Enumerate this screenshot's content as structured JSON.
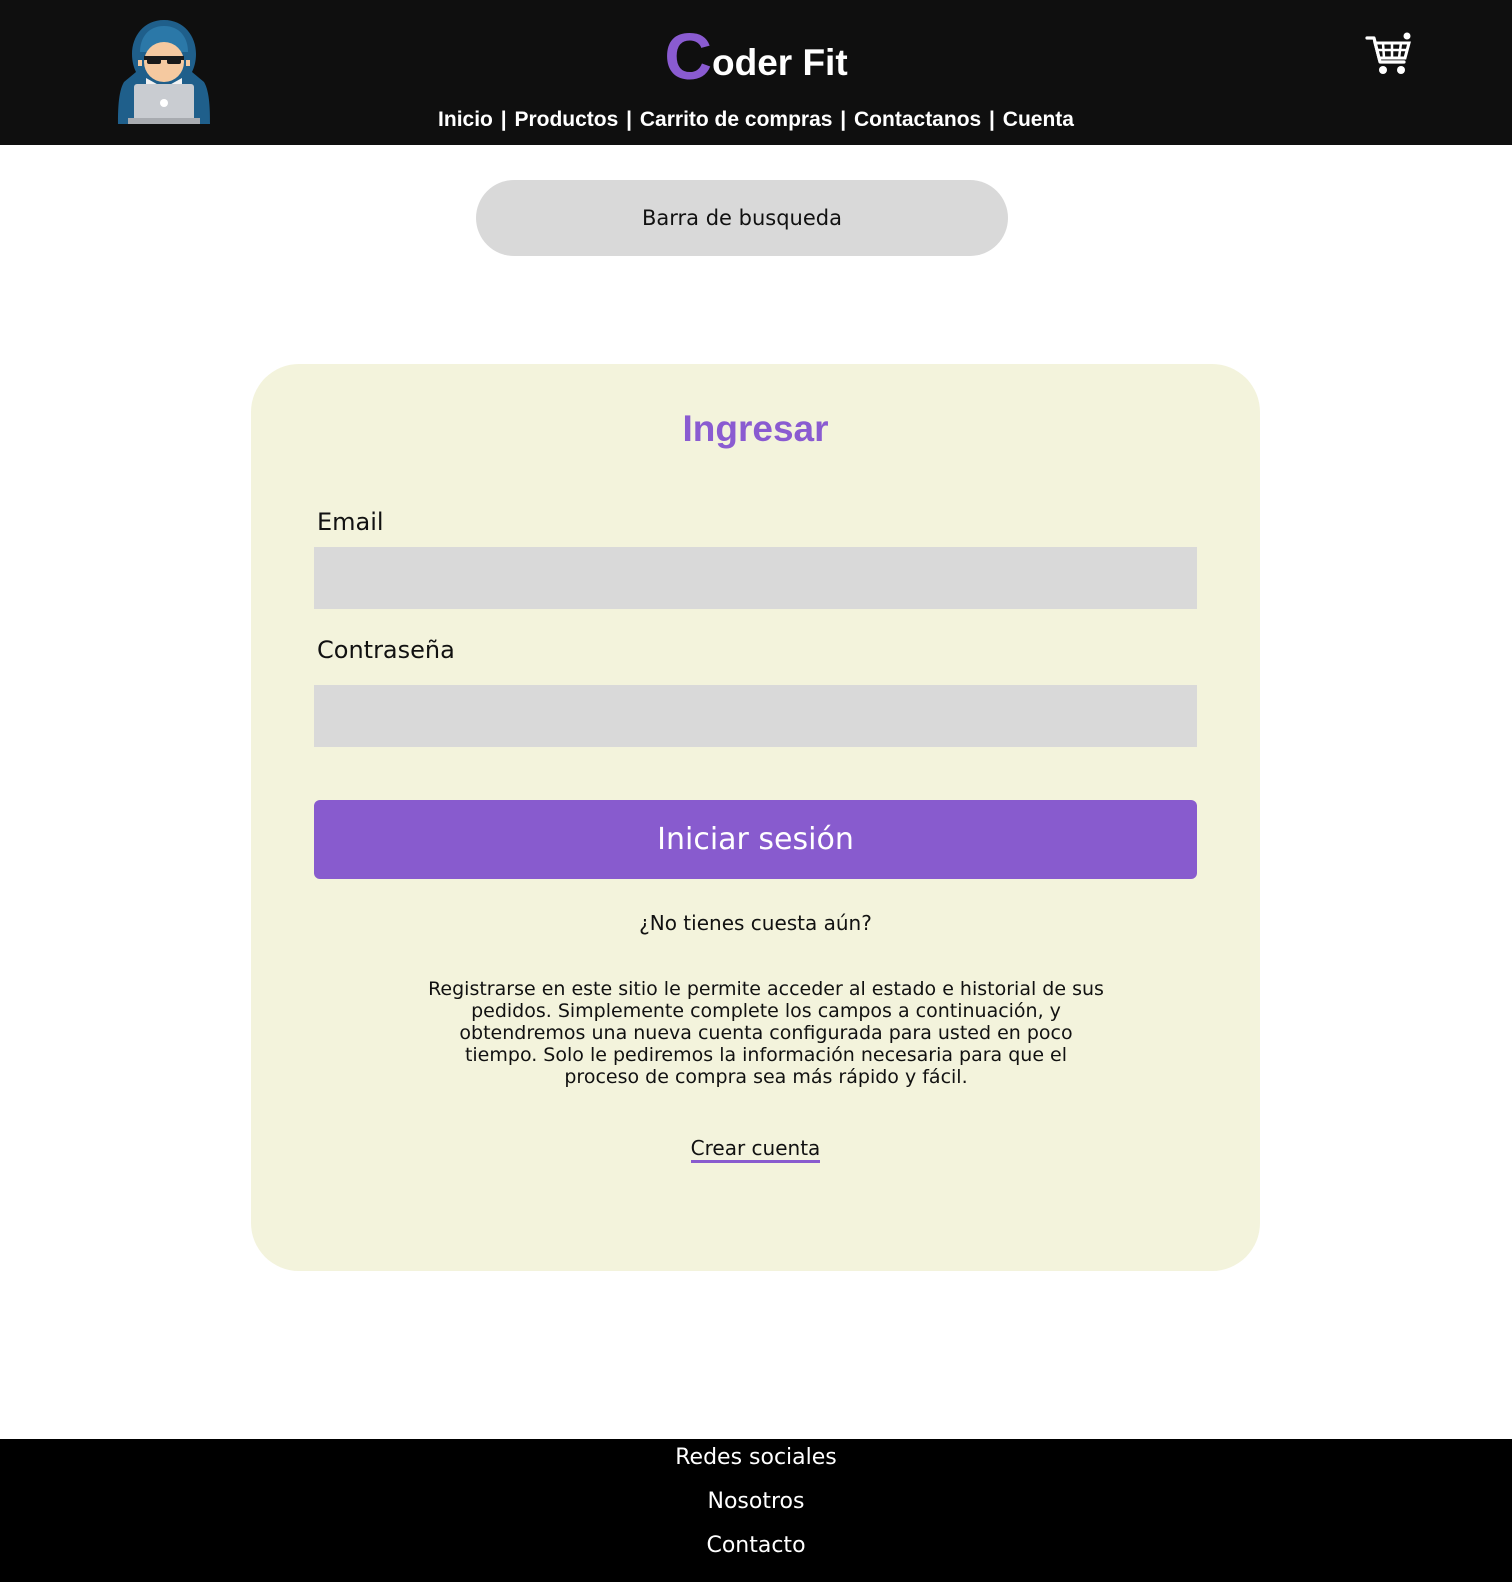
{
  "header": {
    "brand_initial": "C",
    "brand_rest": "oder Fit",
    "nav": [
      {
        "label": "Inicio"
      },
      {
        "label": "Productos"
      },
      {
        "label": "Carrito de compras"
      },
      {
        "label": "Contactanos"
      },
      {
        "label": "Cuenta"
      }
    ],
    "separator": "|",
    "avatar_icon": "hacker-avatar-icon",
    "cart_icon": "shopping-cart-icon"
  },
  "search": {
    "placeholder": "Barra de busqueda"
  },
  "login": {
    "title": "Ingresar",
    "email_label": "Email",
    "email_value": "",
    "password_label": "Contraseña",
    "password_value": "",
    "submit_label": "Iniciar sesión",
    "no_account_text": "¿No tienes cuesta aún?",
    "description": "Registrarse en este sitio le permite acceder al estado e historial de sus pedidos. Simplemente complete los campos a continuación, y obtendremos una nueva cuenta configurada para usted en poco tiempo. Solo le pediremos la información necesaria para que el proceso de compra sea más rápido y fácil.",
    "create_account_label": "Crear cuenta"
  },
  "footer": {
    "items": [
      {
        "label": "Redes sociales"
      },
      {
        "label": "Nosotros"
      },
      {
        "label": "Contacto"
      }
    ]
  },
  "colors": {
    "accent": "#885bce",
    "header_bg": "#0f0f0f",
    "card_bg": "#f3f3dc",
    "field_bg": "#d9d9d9",
    "footer_bg": "#000000"
  }
}
